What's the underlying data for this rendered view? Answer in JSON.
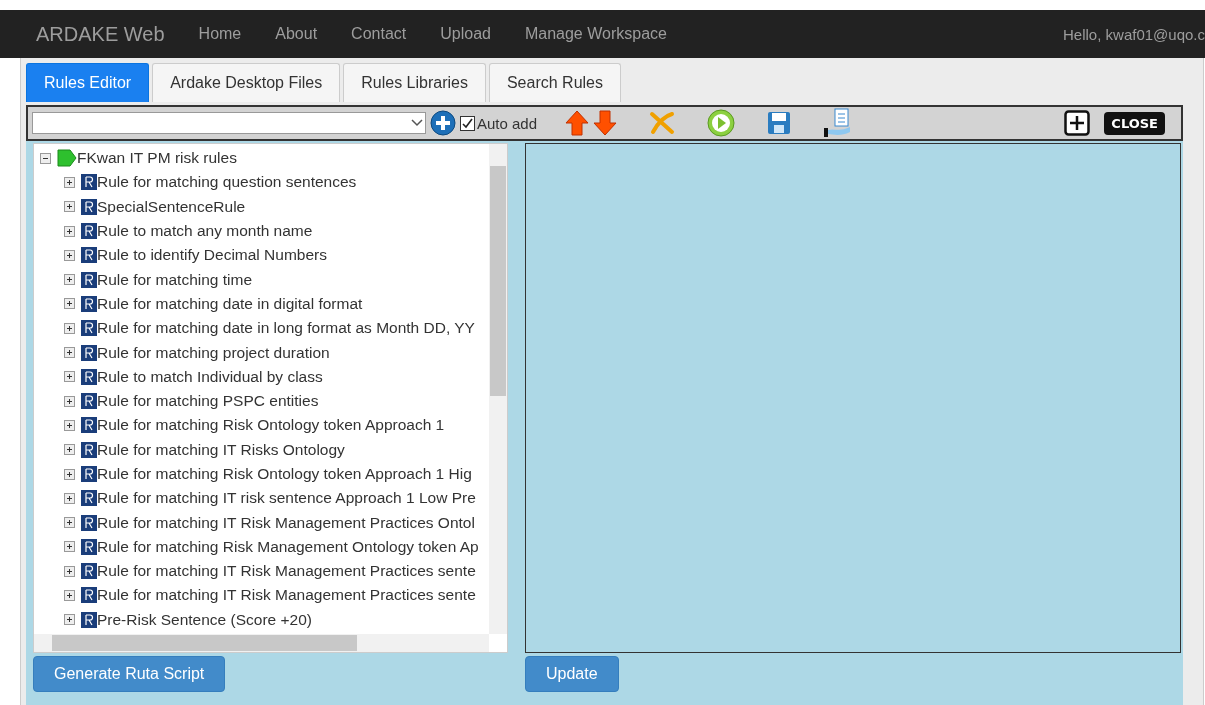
{
  "navbar": {
    "brand": "ARDAKE Web",
    "links": [
      "Home",
      "About",
      "Contact",
      "Upload",
      "Manage Workspace"
    ],
    "greeting": "Hello, kwaf01@uqo.c"
  },
  "tabs": [
    {
      "label": "Rules Editor",
      "selected": true
    },
    {
      "label": "Ardake Desktop Files",
      "selected": false
    },
    {
      "label": "Rules Libraries",
      "selected": false
    },
    {
      "label": "Search Rules",
      "selected": false
    }
  ],
  "toolbar": {
    "auto_add": {
      "label": "Auto add",
      "checked": true
    },
    "close": "CLOSE"
  },
  "tree": {
    "label": "FKwan IT PM risk rules",
    "expanded": true,
    "children": [
      {
        "label": "Rule for matching question sentences",
        "expanded": false
      },
      {
        "label": "SpecialSentenceRule",
        "expanded": false
      },
      {
        "label": "Rule to match any month name",
        "expanded": false
      },
      {
        "label": "Rule to identify Decimal Numbers",
        "expanded": false
      },
      {
        "label": "Rule for matching time",
        "expanded": false
      },
      {
        "label": "Rule for matching date in digital format",
        "expanded": false
      },
      {
        "label": "Rule for matching date in long format as Month DD, YY",
        "expanded": false
      },
      {
        "label": "Rule for matching project duration",
        "expanded": false
      },
      {
        "label": "Rule to match Individual by class",
        "expanded": false
      },
      {
        "label": "Rule for matching PSPC entities",
        "expanded": false
      },
      {
        "label": "Rule for matching Risk Ontology token Approach 1",
        "expanded": false
      },
      {
        "label": "Rule for matching IT Risks Ontology",
        "expanded": false
      },
      {
        "label": "Rule for matching Risk Ontology token Approach 1 Hig",
        "expanded": false
      },
      {
        "label": "Rule for matching IT risk sentence Approach 1 Low Pre",
        "expanded": false
      },
      {
        "label": "Rule for matching IT Risk Management Practices Ontol",
        "expanded": false
      },
      {
        "label": "Rule for matching Risk Management Ontology token Ap",
        "expanded": false
      },
      {
        "label": "Rule for matching IT Risk Management Practices sente",
        "expanded": false
      },
      {
        "label": "Rule for matching IT Risk Management Practices sente",
        "expanded": false
      },
      {
        "label": "Pre-Risk Sentence (Score +20)",
        "expanded": false
      }
    ]
  },
  "buttons": {
    "generate": "Generate Ruta Script",
    "update": "Update"
  }
}
